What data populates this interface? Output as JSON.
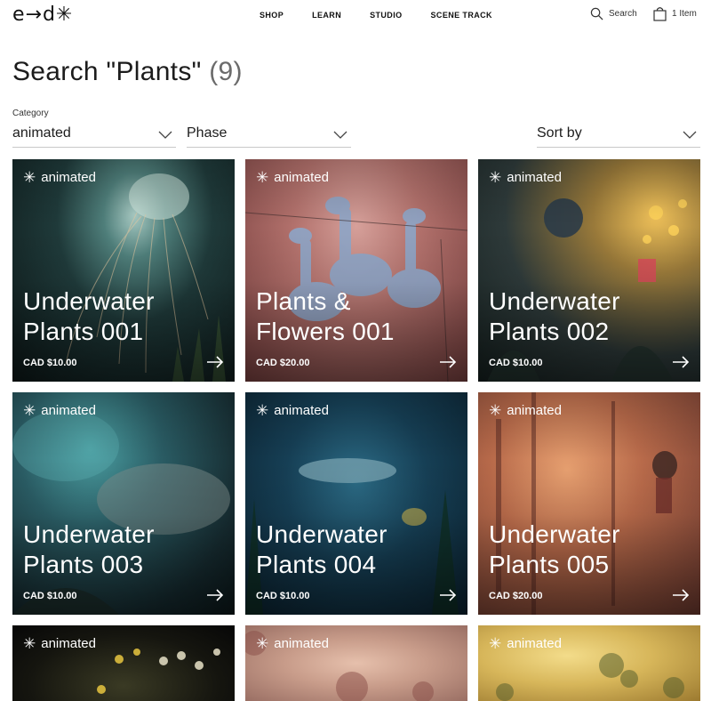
{
  "header": {
    "logo": "e→d✳",
    "nav": [
      "SHOP",
      "LEARN",
      "STUDIO",
      "SCENE TRACK"
    ],
    "search_label": "Search",
    "cart_label": "1 Item"
  },
  "title": {
    "text": "Search \"Plants\"",
    "count": "(9)"
  },
  "filters": {
    "category": {
      "label": "Category",
      "value": "animated"
    },
    "phase": {
      "value": "Phase"
    },
    "sort": {
      "value": "Sort by"
    }
  },
  "products": [
    {
      "tag": "animated",
      "line1": "Underwater",
      "line2": "Plants 001",
      "price": "CAD $10.00"
    },
    {
      "tag": "animated",
      "line1": "Plants &",
      "line2": "Flowers 001",
      "price": "CAD $20.00"
    },
    {
      "tag": "animated",
      "line1": "Underwater",
      "line2": "Plants 002",
      "price": "CAD $10.00"
    },
    {
      "tag": "animated",
      "line1": "Underwater",
      "line2": "Plants 003",
      "price": "CAD $10.00"
    },
    {
      "tag": "animated",
      "line1": "Underwater",
      "line2": "Plants 004",
      "price": "CAD $10.00"
    },
    {
      "tag": "animated",
      "line1": "Underwater",
      "line2": "Plants 005",
      "price": "CAD $20.00"
    },
    {
      "tag": "animated"
    },
    {
      "tag": "animated"
    },
    {
      "tag": "animated"
    }
  ],
  "icons": {
    "search": "search-icon",
    "cart": "bag-icon",
    "chevron": "chevron-down-icon",
    "arrow": "arrow-right-icon",
    "tag": "asterisk-icon"
  }
}
